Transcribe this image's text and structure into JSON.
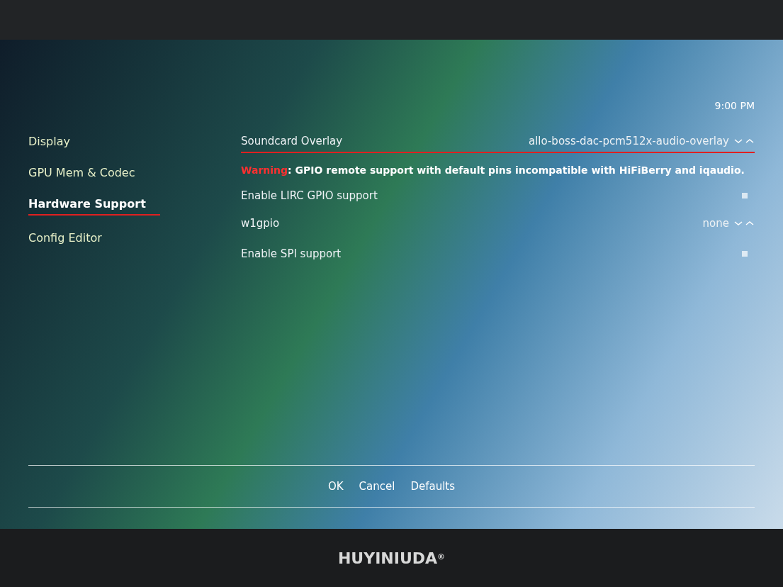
{
  "clock": "9:00 PM",
  "sidebar": {
    "items": [
      {
        "label": "Display",
        "selected": false
      },
      {
        "label": "GPU Mem & Codec",
        "selected": false
      },
      {
        "label": "Hardware Support",
        "selected": true
      },
      {
        "label": "Config Editor",
        "selected": false
      }
    ]
  },
  "settings": [
    {
      "kind": "select",
      "label": "Soundcard Overlay",
      "value": "allo-boss-dac-pcm512x-audio-overlay",
      "focused": true
    },
    {
      "kind": "warning",
      "label": "Warning",
      "message": ": GPIO remote support with default pins incompatible with HiFiBerry and iqaudio."
    },
    {
      "kind": "toggle",
      "label": "Enable LIRC GPIO support",
      "checked": false
    },
    {
      "kind": "select",
      "label": "w1gpio",
      "value": "none",
      "focused": false
    },
    {
      "kind": "toggle",
      "label": "Enable SPI support",
      "checked": false
    }
  ],
  "buttons": [
    "OK",
    "Cancel",
    "Defaults"
  ],
  "monitor": {
    "brand": "HUYINIUDA",
    "mark": "®"
  }
}
